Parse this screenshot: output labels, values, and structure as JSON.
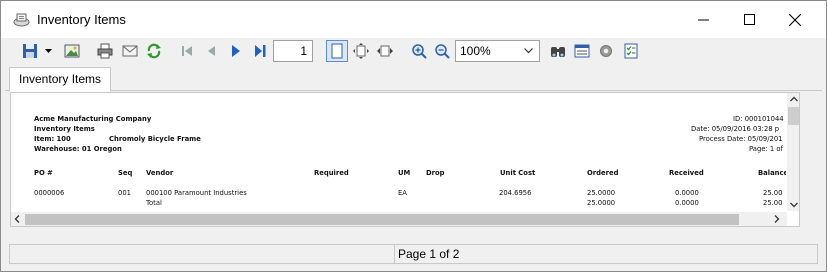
{
  "window": {
    "title": "Inventory Items"
  },
  "toolbar": {
    "page_number": "1",
    "zoom": "100%"
  },
  "tabs": [
    {
      "label": "Inventory Items"
    }
  ],
  "report": {
    "company": "Acme Manufacturing Company",
    "report_title": "Inventory Items",
    "item_label": "Item: 100",
    "item_desc": "Chromoly Bicycle Frame",
    "warehouse": "Warehouse: 01 Oregon",
    "id": "ID: 000101044",
    "date": "Date: 05/09/2016 03:28 p",
    "process_date": "Process Date: 05/09/201",
    "page": "Page: 1 of",
    "columns": {
      "po": "PO #",
      "seq": "Seq",
      "vendor": "Vendor",
      "required": "Required",
      "um": "UM",
      "drop": "Drop",
      "unit_cost": "Unit Cost",
      "ordered": "Ordered",
      "received": "Received",
      "balance": "Balance"
    },
    "row": {
      "po": "0000006",
      "seq": "001",
      "vendor": "000100 Paramount Industries",
      "um": "EA",
      "unit_cost": "204.6956",
      "ordered": "25.0000",
      "received": "0.0000",
      "balance": "25.00"
    },
    "total": {
      "label": "Total",
      "ordered": "25.0000",
      "received": "0.0000",
      "balance": "25.00"
    }
  },
  "status": {
    "left": "",
    "page_info": "Page 1 of 2"
  }
}
